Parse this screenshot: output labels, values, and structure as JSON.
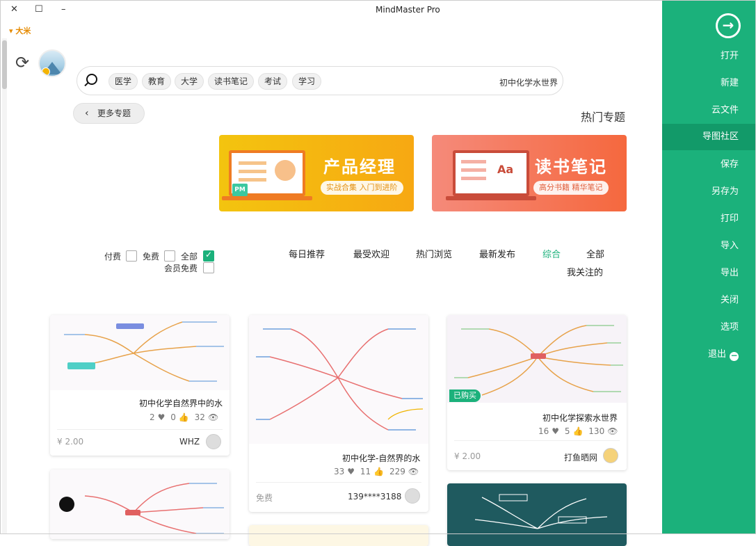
{
  "window": {
    "title": "MindMaster Pro",
    "close": "✕",
    "maximize": "☐",
    "minimize": "–",
    "user": "大米",
    "user_arrow": "▾"
  },
  "sidebar": {
    "back": "→",
    "items": [
      {
        "label": "打开"
      },
      {
        "label": "新建"
      },
      {
        "label": "云文件"
      },
      {
        "label": "导图社区"
      },
      {
        "label": "保存"
      },
      {
        "label": "另存为"
      },
      {
        "label": "打印"
      },
      {
        "label": "导入"
      },
      {
        "label": "导出"
      },
      {
        "label": "关闭"
      },
      {
        "label": "选项"
      },
      {
        "label": "退出"
      }
    ]
  },
  "search": {
    "value": "初中化学水世界",
    "tags": [
      "学习",
      "考试",
      "读书笔记",
      "大学",
      "教育",
      "医学"
    ]
  },
  "topics": {
    "heading": "热门专题",
    "more_label": "更多专题",
    "banners": [
      {
        "title": "读书笔记",
        "subtitle": "高分书籍 精华笔记",
        "badge": "Aa"
      },
      {
        "title": "产品经理",
        "subtitle": "实战合集 入门到进阶",
        "badge": "PM"
      }
    ]
  },
  "filters": {
    "tabs": [
      "全部",
      "综合",
      "最新发布",
      "热门浏览",
      "最受欢迎",
      "每日推荐"
    ],
    "tab_row2": "我关注的",
    "price_options": [
      "全部",
      "免费",
      "付费"
    ],
    "member_free": "会员免费"
  },
  "cards": [
    {
      "title": "初中化学探索水世界",
      "views": "130",
      "likes": "5",
      "favs": "16",
      "author": "打鱼晒网",
      "price": "¥ 2.00",
      "tag": "已购买"
    },
    {
      "title": "初中化学-自然界的水",
      "views": "229",
      "likes": "11",
      "favs": "33",
      "author": "139****3188",
      "price": "免费"
    },
    {
      "title": "初中化学自然界中的水",
      "views": "32",
      "likes": "0",
      "favs": "2",
      "author": "WHZ",
      "price": "¥ 2.00"
    }
  ],
  "icons": {
    "refresh": "⟳",
    "eye": "👁",
    "thumb": "👍",
    "heart": "♥",
    "chevron": "‹",
    "exit": "−"
  },
  "colors": {
    "accent": "#1bb17b",
    "accent_dark": "#129a69",
    "user": "#e58a00"
  }
}
